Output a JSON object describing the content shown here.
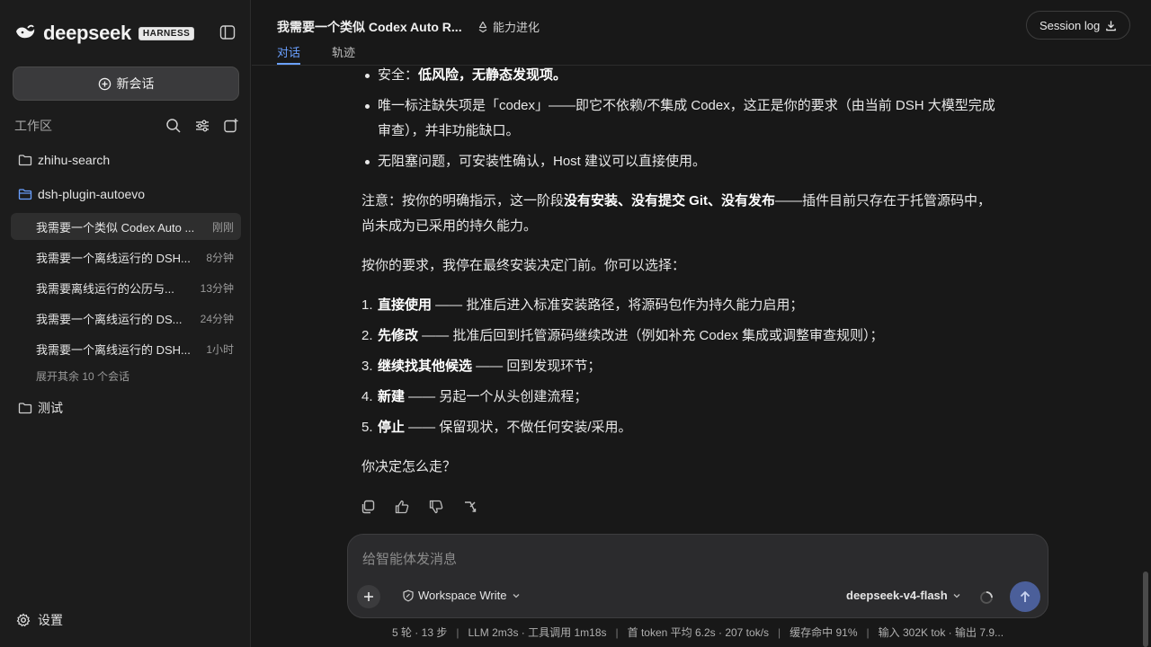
{
  "brand": {
    "name": "deepseek",
    "badge": "HARNESS"
  },
  "sidebar": {
    "new_chat_label": "新会话",
    "workspace_label": "工作区",
    "folders": [
      {
        "name": "zhihu-search"
      },
      {
        "name": "dsh-plugin-autoevo"
      },
      {
        "name": "测试"
      }
    ],
    "conversations": [
      {
        "title": "我需要一个类似 Codex Auto ...",
        "time": "刚刚"
      },
      {
        "title": "我需要一个离线运行的 DSH...",
        "time": "8分钟"
      },
      {
        "title": "我需要离线运行的公历与...",
        "time": "13分钟"
      },
      {
        "title": "我需要一个离线运行的 DS...",
        "time": "24分钟"
      },
      {
        "title": "我需要一个离线运行的 DSH...",
        "time": "1小时"
      }
    ],
    "more_label": "展开其余 10 个会话",
    "settings_label": "设置"
  },
  "header": {
    "title": "我需要一个类似 Codex Auto R...",
    "capability": "能力进化",
    "tabs": [
      {
        "label": "对话"
      },
      {
        "label": "轨迹"
      }
    ],
    "session_log": "Session log"
  },
  "message": {
    "bullets": [
      {
        "prefix": "安全：",
        "bold": "低风险，无静态发现项。",
        "rest": ""
      },
      {
        "prefix": "唯一标注缺失项是「codex」——即它不依赖/不集成 Codex，这正是你的要求（由当前 DSH 大模型完成",
        "line2": "审查），并非功能缺口。"
      },
      {
        "text": "无阻塞问题，可安装性确认，Host 建议可以直接使用。"
      }
    ],
    "note": {
      "prefix": "注意：按你的明确指示，这一阶段",
      "bold": "没有安装、没有提交 Git、没有发布",
      "rest": "——插件目前只存在于托管源码中，",
      "line2": "尚未成为已采用的持久能力。"
    },
    "intro": "按你的要求，我停在最终安装决定门前。你可以选择：",
    "options": [
      {
        "num": "1.",
        "bold": "直接使用",
        "rest": " —— 批准后进入标准安装路径，将源码包作为持久能力启用；"
      },
      {
        "num": "2.",
        "bold": "先修改",
        "rest": " —— 批准后回到托管源码继续改进（例如补充 Codex 集成或调整审查规则）；"
      },
      {
        "num": "3.",
        "bold": "继续找其他候选",
        "rest": " —— 回到发现环节；"
      },
      {
        "num": "4.",
        "bold": "新建",
        "rest": " —— 另起一个从头创建流程；"
      },
      {
        "num": "5.",
        "bold": "停止",
        "rest": " —— 保留现状，不做任何安装/采用。"
      }
    ],
    "question": "你决定怎么走？"
  },
  "composer": {
    "placeholder": "给智能体发消息",
    "mode": "Workspace Write",
    "model": "deepseek-v4-flash"
  },
  "status": {
    "rounds": "5 轮 · 13 步",
    "llm": "LLM 2m3s · 工具调用 1m18s",
    "token": "首 token 平均 6.2s · 207 tok/s",
    "cache": "缓存命中 91%",
    "io": "输入 302K tok · 输出 7.9..."
  }
}
